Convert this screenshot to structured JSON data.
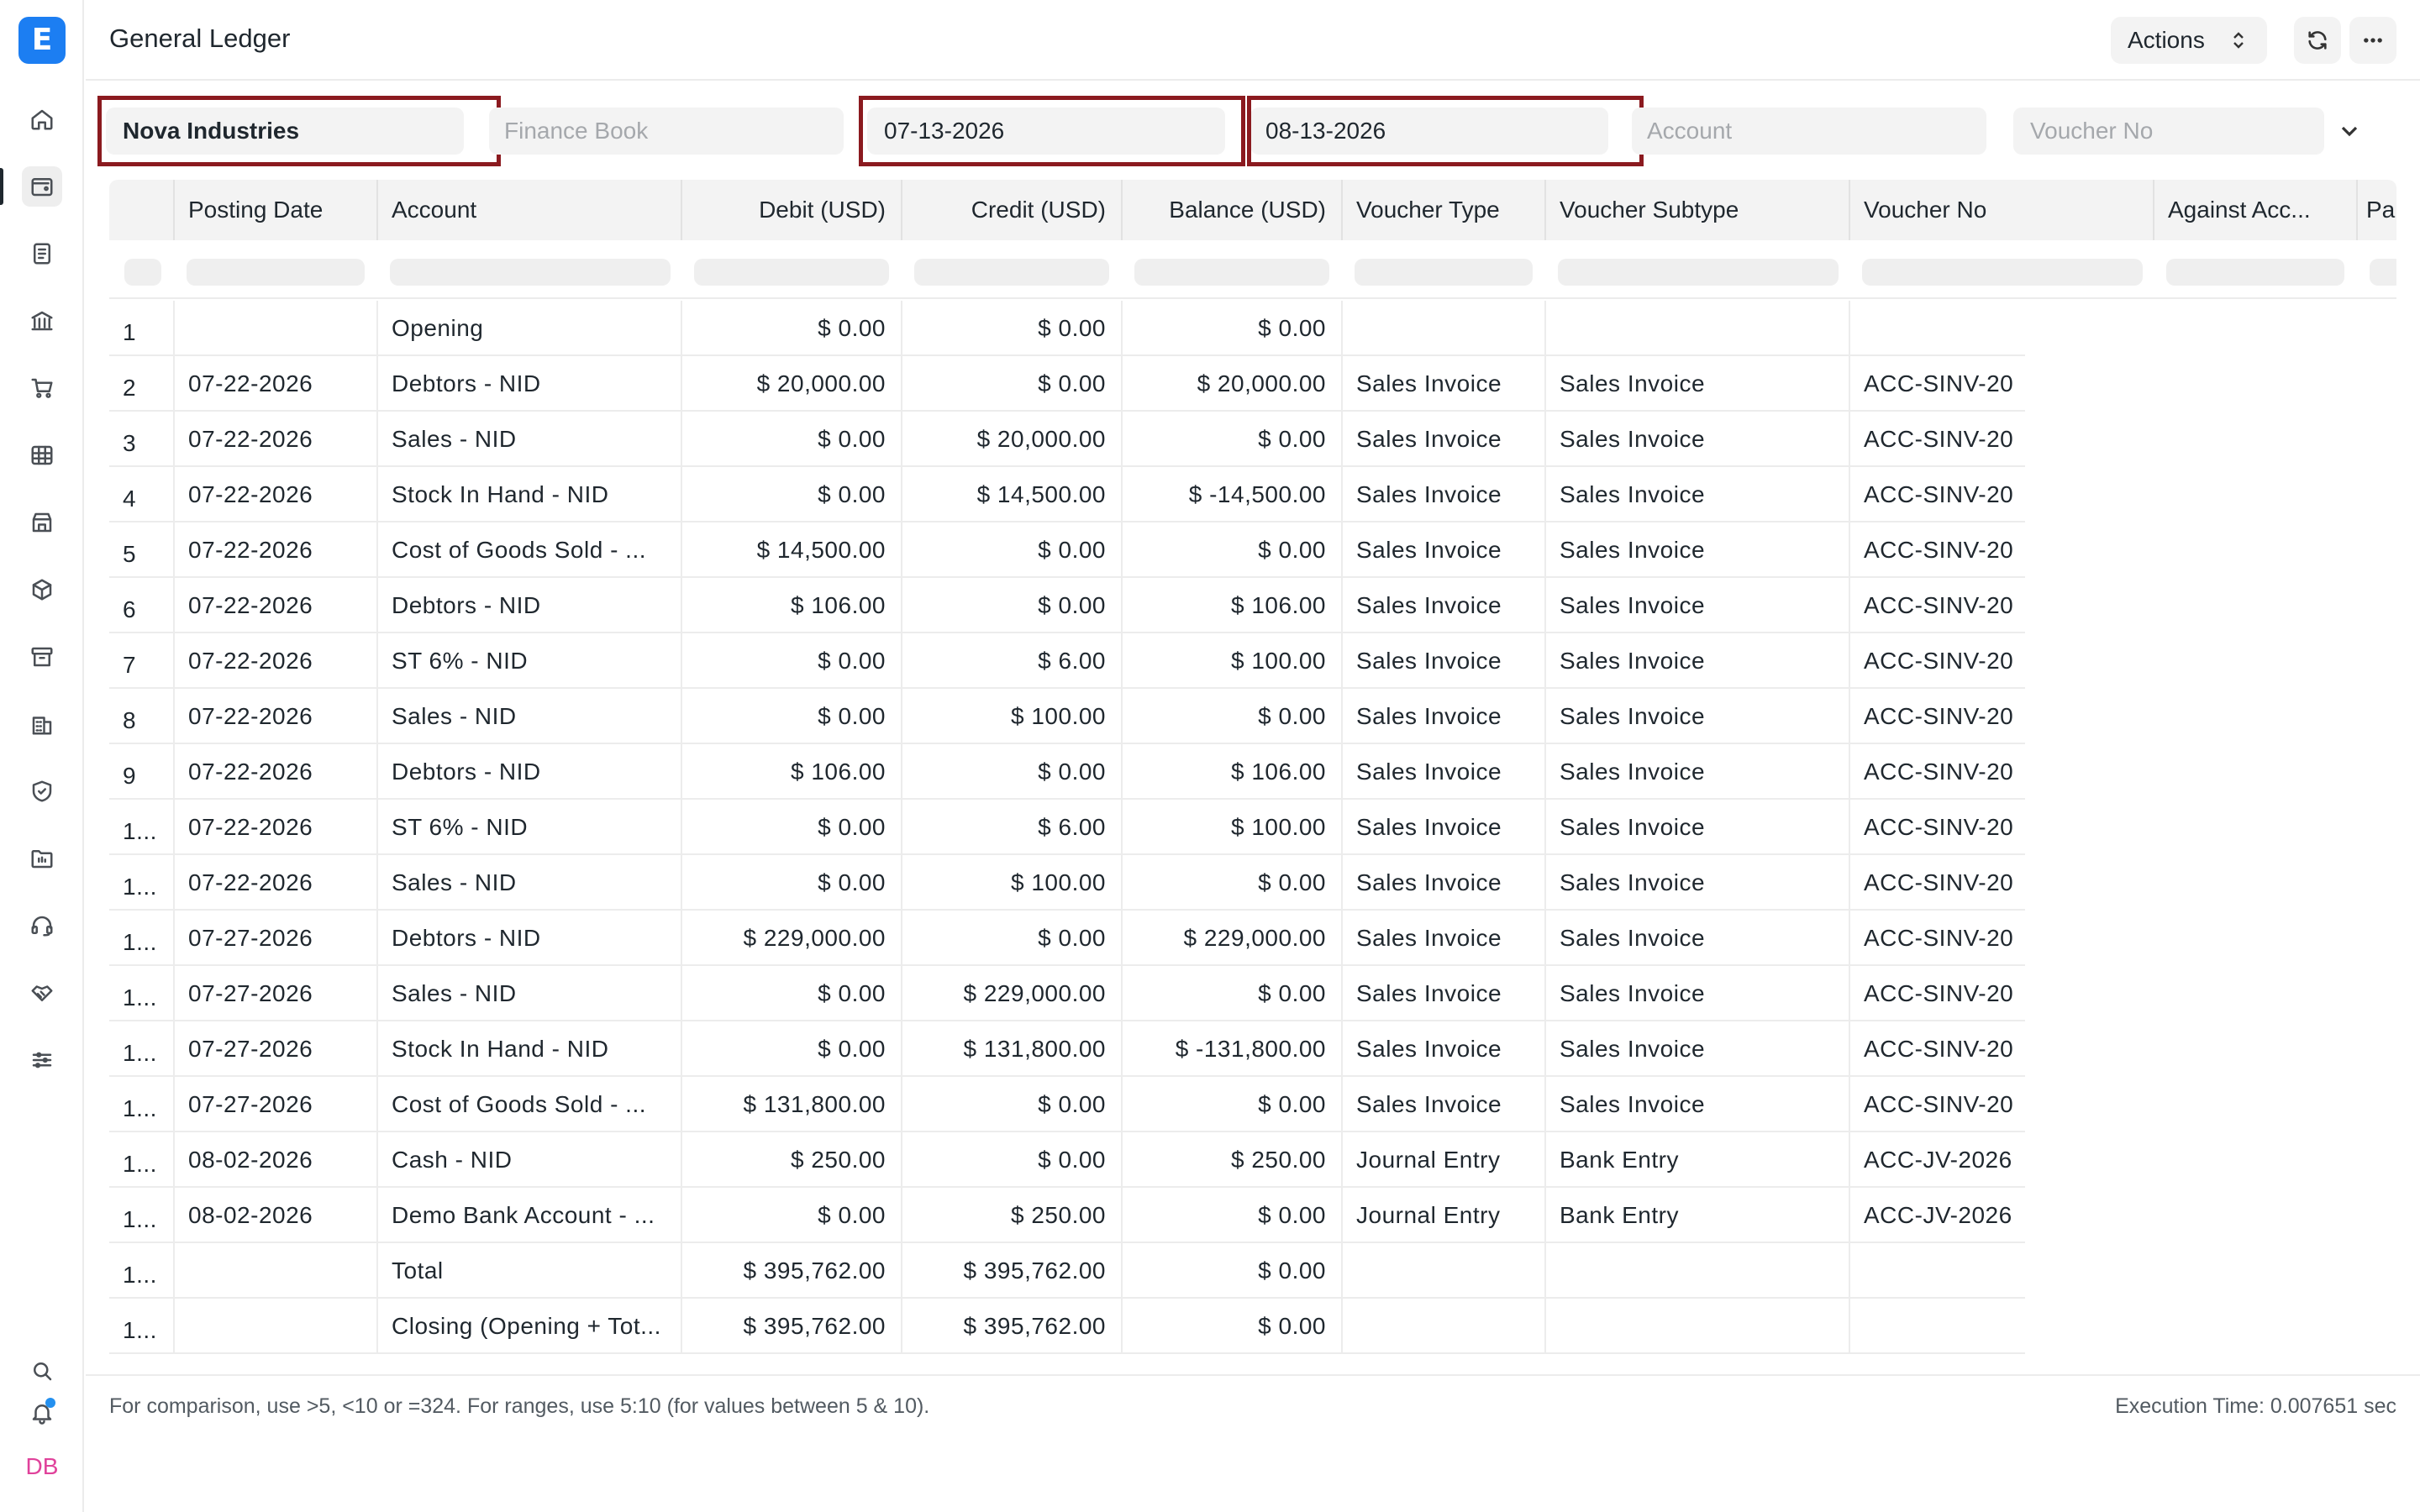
{
  "app": {
    "logo_letter": "E"
  },
  "header": {
    "title": "General Ledger",
    "actions_label": "Actions"
  },
  "filters": {
    "company": "Nova Industries",
    "finance_book_placeholder": "Finance Book",
    "from_date": "07-13-2026",
    "to_date": "08-13-2026",
    "account_placeholder": "Account",
    "voucher_no_placeholder": "Voucher No"
  },
  "table": {
    "columns": [
      "Posting Date",
      "Account",
      "Debit (USD)",
      "Credit (USD)",
      "Balance (USD)",
      "Voucher Type",
      "Voucher Subtype",
      "Voucher No",
      "Against Acc...",
      "Pa"
    ],
    "rows": [
      {
        "idx": "1",
        "date": "",
        "account": "Opening",
        "debit": "$ 0.00",
        "credit": "$ 0.00",
        "balance": "$ 0.00",
        "vtype": "",
        "vsubtype": "",
        "vno": ""
      },
      {
        "idx": "2",
        "date": "07-22-2026",
        "account": "Debtors - NID",
        "debit": "$ 20,000.00",
        "credit": "$ 0.00",
        "balance": "$ 20,000.00",
        "vtype": "Sales Invoice",
        "vsubtype": "Sales Invoice",
        "vno": "ACC-SINV-20"
      },
      {
        "idx": "3",
        "date": "07-22-2026",
        "account": "Sales - NID",
        "debit": "$ 0.00",
        "credit": "$ 20,000.00",
        "balance": "$ 0.00",
        "vtype": "Sales Invoice",
        "vsubtype": "Sales Invoice",
        "vno": "ACC-SINV-20"
      },
      {
        "idx": "4",
        "date": "07-22-2026",
        "account": "Stock In Hand - NID",
        "debit": "$ 0.00",
        "credit": "$ 14,500.00",
        "balance": "$ -14,500.00",
        "vtype": "Sales Invoice",
        "vsubtype": "Sales Invoice",
        "vno": "ACC-SINV-20"
      },
      {
        "idx": "5",
        "date": "07-22-2026",
        "account": "Cost of Goods Sold - ...",
        "debit": "$ 14,500.00",
        "credit": "$ 0.00",
        "balance": "$ 0.00",
        "vtype": "Sales Invoice",
        "vsubtype": "Sales Invoice",
        "vno": "ACC-SINV-20"
      },
      {
        "idx": "6",
        "date": "07-22-2026",
        "account": "Debtors - NID",
        "debit": "$ 106.00",
        "credit": "$ 0.00",
        "balance": "$ 106.00",
        "vtype": "Sales Invoice",
        "vsubtype": "Sales Invoice",
        "vno": "ACC-SINV-20"
      },
      {
        "idx": "7",
        "date": "07-22-2026",
        "account": "ST 6% - NID",
        "debit": "$ 0.00",
        "credit": "$ 6.00",
        "balance": "$ 100.00",
        "vtype": "Sales Invoice",
        "vsubtype": "Sales Invoice",
        "vno": "ACC-SINV-20"
      },
      {
        "idx": "8",
        "date": "07-22-2026",
        "account": "Sales - NID",
        "debit": "$ 0.00",
        "credit": "$ 100.00",
        "balance": "$ 0.00",
        "vtype": "Sales Invoice",
        "vsubtype": "Sales Invoice",
        "vno": "ACC-SINV-20"
      },
      {
        "idx": "9",
        "date": "07-22-2026",
        "account": "Debtors - NID",
        "debit": "$ 106.00",
        "credit": "$ 0.00",
        "balance": "$ 106.00",
        "vtype": "Sales Invoice",
        "vsubtype": "Sales Invoice",
        "vno": "ACC-SINV-20"
      },
      {
        "idx": "1...",
        "date": "07-22-2026",
        "account": "ST 6% - NID",
        "debit": "$ 0.00",
        "credit": "$ 6.00",
        "balance": "$ 100.00",
        "vtype": "Sales Invoice",
        "vsubtype": "Sales Invoice",
        "vno": "ACC-SINV-20"
      },
      {
        "idx": "1...",
        "date": "07-22-2026",
        "account": "Sales - NID",
        "debit": "$ 0.00",
        "credit": "$ 100.00",
        "balance": "$ 0.00",
        "vtype": "Sales Invoice",
        "vsubtype": "Sales Invoice",
        "vno": "ACC-SINV-20"
      },
      {
        "idx": "1...",
        "date": "07-27-2026",
        "account": "Debtors - NID",
        "debit": "$ 229,000.00",
        "credit": "$ 0.00",
        "balance": "$ 229,000.00",
        "vtype": "Sales Invoice",
        "vsubtype": "Sales Invoice",
        "vno": "ACC-SINV-20"
      },
      {
        "idx": "1...",
        "date": "07-27-2026",
        "account": "Sales - NID",
        "debit": "$ 0.00",
        "credit": "$ 229,000.00",
        "balance": "$ 0.00",
        "vtype": "Sales Invoice",
        "vsubtype": "Sales Invoice",
        "vno": "ACC-SINV-20"
      },
      {
        "idx": "1...",
        "date": "07-27-2026",
        "account": "Stock In Hand - NID",
        "debit": "$ 0.00",
        "credit": "$ 131,800.00",
        "balance": "$ -131,800.00",
        "vtype": "Sales Invoice",
        "vsubtype": "Sales Invoice",
        "vno": "ACC-SINV-20"
      },
      {
        "idx": "1...",
        "date": "07-27-2026",
        "account": "Cost of Goods Sold - ...",
        "debit": "$ 131,800.00",
        "credit": "$ 0.00",
        "balance": "$ 0.00",
        "vtype": "Sales Invoice",
        "vsubtype": "Sales Invoice",
        "vno": "ACC-SINV-20"
      },
      {
        "idx": "1...",
        "date": "08-02-2026",
        "account": "Cash - NID",
        "debit": "$ 250.00",
        "credit": "$ 0.00",
        "balance": "$ 250.00",
        "vtype": "Journal Entry",
        "vsubtype": "Bank Entry",
        "vno": "ACC-JV-2026"
      },
      {
        "idx": "1...",
        "date": "08-02-2026",
        "account": "Demo Bank Account - ...",
        "debit": "$ 0.00",
        "credit": "$ 250.00",
        "balance": "$ 0.00",
        "vtype": "Journal Entry",
        "vsubtype": "Bank Entry",
        "vno": "ACC-JV-2026"
      },
      {
        "idx": "1...",
        "date": "",
        "account": "Total",
        "debit": "$ 395,762.00",
        "credit": "$ 395,762.00",
        "balance": "$ 0.00",
        "vtype": "",
        "vsubtype": "",
        "vno": ""
      },
      {
        "idx": "1...",
        "date": "",
        "account": "Closing (Opening + Tot...",
        "debit": "$ 395,762.00",
        "credit": "$ 395,762.00",
        "balance": "$ 0.00",
        "vtype": "",
        "vsubtype": "",
        "vno": ""
      }
    ]
  },
  "footer": {
    "hint": "For comparison, use >5, <10 or =324. For ranges, use 5:10 (for values between 5 & 10).",
    "execution_time": "Execution Time: 0.007651 sec"
  },
  "user": {
    "initials": "DB"
  },
  "icons": {
    "sidebar": [
      "home-icon",
      "wallet-icon",
      "document-icon",
      "bank-icon",
      "cart-icon",
      "table-icon",
      "store-icon",
      "package-icon",
      "archive-icon",
      "building-icon",
      "shield-icon",
      "folder-icon",
      "headset-icon",
      "handshake-icon",
      "sliders-icon",
      "search-icon",
      "bell-icon"
    ]
  },
  "colors": {
    "highlight": "#8b1a1f",
    "brand": "#1c7ef2",
    "avatar": "#e0429b"
  }
}
